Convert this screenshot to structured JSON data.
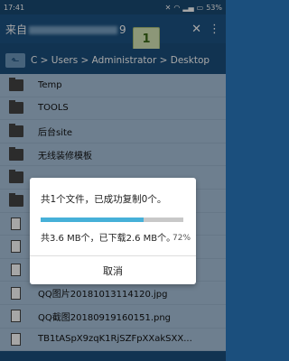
{
  "status": {
    "time": "17:41",
    "battery": "53%"
  },
  "app": {
    "title_prefix": "来自",
    "title_suffix": "9",
    "tab_count": "1"
  },
  "path": {
    "text": "C > Users > Administrator > Desktop"
  },
  "files": [
    {
      "name": "Temp",
      "type": "folder"
    },
    {
      "name": "TOOLS",
      "type": "folder"
    },
    {
      "name": "后台site",
      "type": "folder"
    },
    {
      "name": "无线装修模板",
      "type": "folder"
    },
    {
      "name": "",
      "type": "folder"
    },
    {
      "name": "",
      "type": "folder"
    },
    {
      "name": "",
      "type": "file"
    },
    {
      "name": "",
      "type": "file"
    },
    {
      "name": "",
      "type": "file"
    },
    {
      "name": "QQ图片20181013114120.jpg",
      "type": "file"
    },
    {
      "name": "QQ截图20180919160151.png",
      "type": "file"
    },
    {
      "name": "TB1tASpX9zqK1RjSZFpXXakSXX...",
      "type": "file"
    }
  ],
  "dialog": {
    "message": "共1个文件，已成功复制0个。",
    "size_text": "共3.6 MB个，已下载2.6 MB个。",
    "percent_text": "72%",
    "progress": 0.72,
    "cancel_label": "取消"
  }
}
